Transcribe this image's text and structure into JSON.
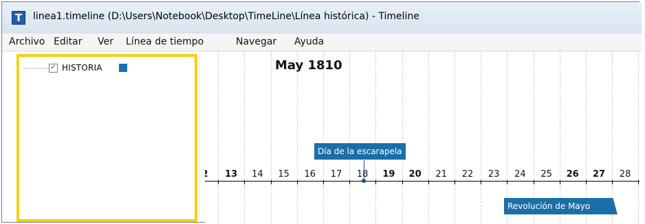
{
  "window": {
    "title": "linea1.timeline (D:\\Users\\Notebook\\Desktop\\TimeLine\\Línea histórica) - Timeline",
    "icon": "timeline-app-icon"
  },
  "menu": {
    "items": [
      "Archivo",
      "Editar",
      "Ver",
      "Línea de tiempo",
      "Navegar",
      "Ayuda"
    ]
  },
  "sidebar": {
    "category": {
      "label": "HISTORIA",
      "checked": true,
      "color": "#1a6fb0"
    }
  },
  "timeline": {
    "period": "May 1810",
    "days": [
      {
        "label": "2",
        "bold": true
      },
      {
        "label": "13",
        "bold": true
      },
      {
        "label": "14",
        "bold": false
      },
      {
        "label": "15",
        "bold": false
      },
      {
        "label": "16",
        "bold": false
      },
      {
        "label": "17",
        "bold": false
      },
      {
        "label": "18",
        "bold": false
      },
      {
        "label": "19",
        "bold": true
      },
      {
        "label": "20",
        "bold": true
      },
      {
        "label": "21",
        "bold": false
      },
      {
        "label": "22",
        "bold": false
      },
      {
        "label": "23",
        "bold": false
      },
      {
        "label": "24",
        "bold": false
      },
      {
        "label": "25",
        "bold": false
      },
      {
        "label": "26",
        "bold": true
      },
      {
        "label": "27",
        "bold": true
      },
      {
        "label": "28",
        "bold": false
      }
    ],
    "events": [
      {
        "title": "Día de la escarapela",
        "date_label": "18"
      },
      {
        "title": "Revolución de Mayo",
        "start_label": "24"
      }
    ],
    "event_color": "#1a6fa9"
  }
}
